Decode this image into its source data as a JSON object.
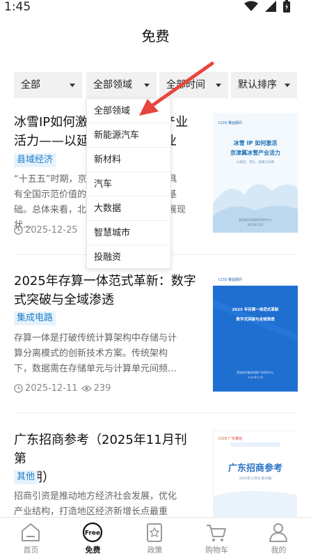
{
  "status_bar": {
    "time": "1:45"
  },
  "page": {
    "title": "免费"
  },
  "filters": [
    {
      "label": "全部"
    },
    {
      "label": "全部领域"
    },
    {
      "label": "全部时间"
    },
    {
      "label": "默认排序"
    }
  ],
  "dropdown": {
    "items": [
      "全部领域",
      "新能源汽车",
      "新材料",
      "汽车",
      "大数据",
      "智慧城市",
      "投融资"
    ]
  },
  "articles": [
    {
      "title_l1": "冰雪IP如何激活京津冀冰雪产业",
      "title_l2": "活力——以延庆为例冰雪产业",
      "tag": "县域经济",
      "summary_l1": "“十五五”时期，京津冀冰雪产业将打造具",
      "summary_l2": "有全国示范价值的冰雪经济高质量发展基",
      "summary_l3": "础。总体来看，北京延庆区冰雪产业发展现状...",
      "date": "2025-12-25",
      "views": "",
      "cover": {
        "brand": "CCID 赛迪顾问",
        "line1": "冰雪 IP 如何激活",
        "line2": "京津冀冰雪产业活力",
        "line3": "以延庆、崇礼、张家口为例",
        "line4": "赛迪顾问县域经济研究中心",
        "line5": "2025年12月"
      }
    },
    {
      "title_l1": "2025年存算一体范式革新：数字",
      "title_l2": "式突破与全域渗透",
      "tag": "集成电路",
      "summary_l1": "存算一体是打破传统计算架构中存储与计",
      "summary_l2": "算分离模式的创新技术方案。传统架构",
      "summary_l3": "下，数据需在存储单元与计算单元间频…",
      "date": "2025-12-11",
      "views": "239",
      "cover": {
        "brand": "CCID 赛迪顾问",
        "line1": "2025 年存算一体范式革新",
        "line2": "数字式突破与全域渗透",
        "line3": "赛迪顾问集成电路产业研究中心",
        "line4": "2025年12月"
      }
    },
    {
      "title_l1": "广东招商参考（2025年11月刊第",
      "title_l2": "26期）",
      "tag": "其他",
      "summary_l1": "招商引资是推动地方经济社会发展，优化",
      "summary_l2": "产业结构，打造地区经济新增长点最重",
      "summary_l3": "",
      "date": "",
      "views": "",
      "cover": {
        "brand": "CCID 广东赛迪",
        "line1": "广东招商参考",
        "line2": "2025年11月刊 第26期"
      }
    }
  ],
  "tabbar": [
    {
      "label": "首页",
      "icon": "home-icon"
    },
    {
      "label": "免费",
      "icon": "free-icon",
      "badge": "Free"
    },
    {
      "label": "政策",
      "icon": "policy-icon"
    },
    {
      "label": "购物车",
      "icon": "cart-icon"
    },
    {
      "label": "我的",
      "icon": "profile-icon"
    }
  ],
  "colors": {
    "accent_blue": "#1d7fc8",
    "tag_bg": "#e7f3fc",
    "arrow_red": "#e8453c",
    "cover_blue": "#1f6fd1"
  }
}
